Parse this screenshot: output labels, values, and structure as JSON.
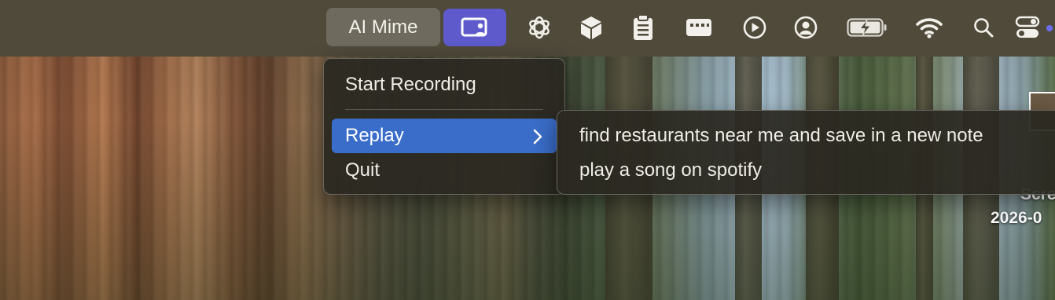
{
  "menubar": {
    "app_name": "AI Mime",
    "status_icons": [
      "ai-mime-app-icon",
      "chatgpt-icon",
      "cube-icon",
      "clipboard-icon",
      "keyboard-icon",
      "play-icon",
      "user-account-icon",
      "battery-charging-icon",
      "wifi-icon",
      "search-icon",
      "control-center-icon"
    ],
    "accent_color": "#5e5acb"
  },
  "menu": {
    "items": [
      {
        "label": "Start Recording"
      },
      {
        "label": "Replay",
        "has_submenu": true
      },
      {
        "label": "Quit"
      }
    ]
  },
  "submenu": {
    "items": [
      {
        "label": "find restaurants near me and save in a new note"
      },
      {
        "label": "play a song on spotify"
      }
    ]
  },
  "desktop": {
    "partial_label_1": "Scre",
    "partial_label_2": "2026-0"
  }
}
